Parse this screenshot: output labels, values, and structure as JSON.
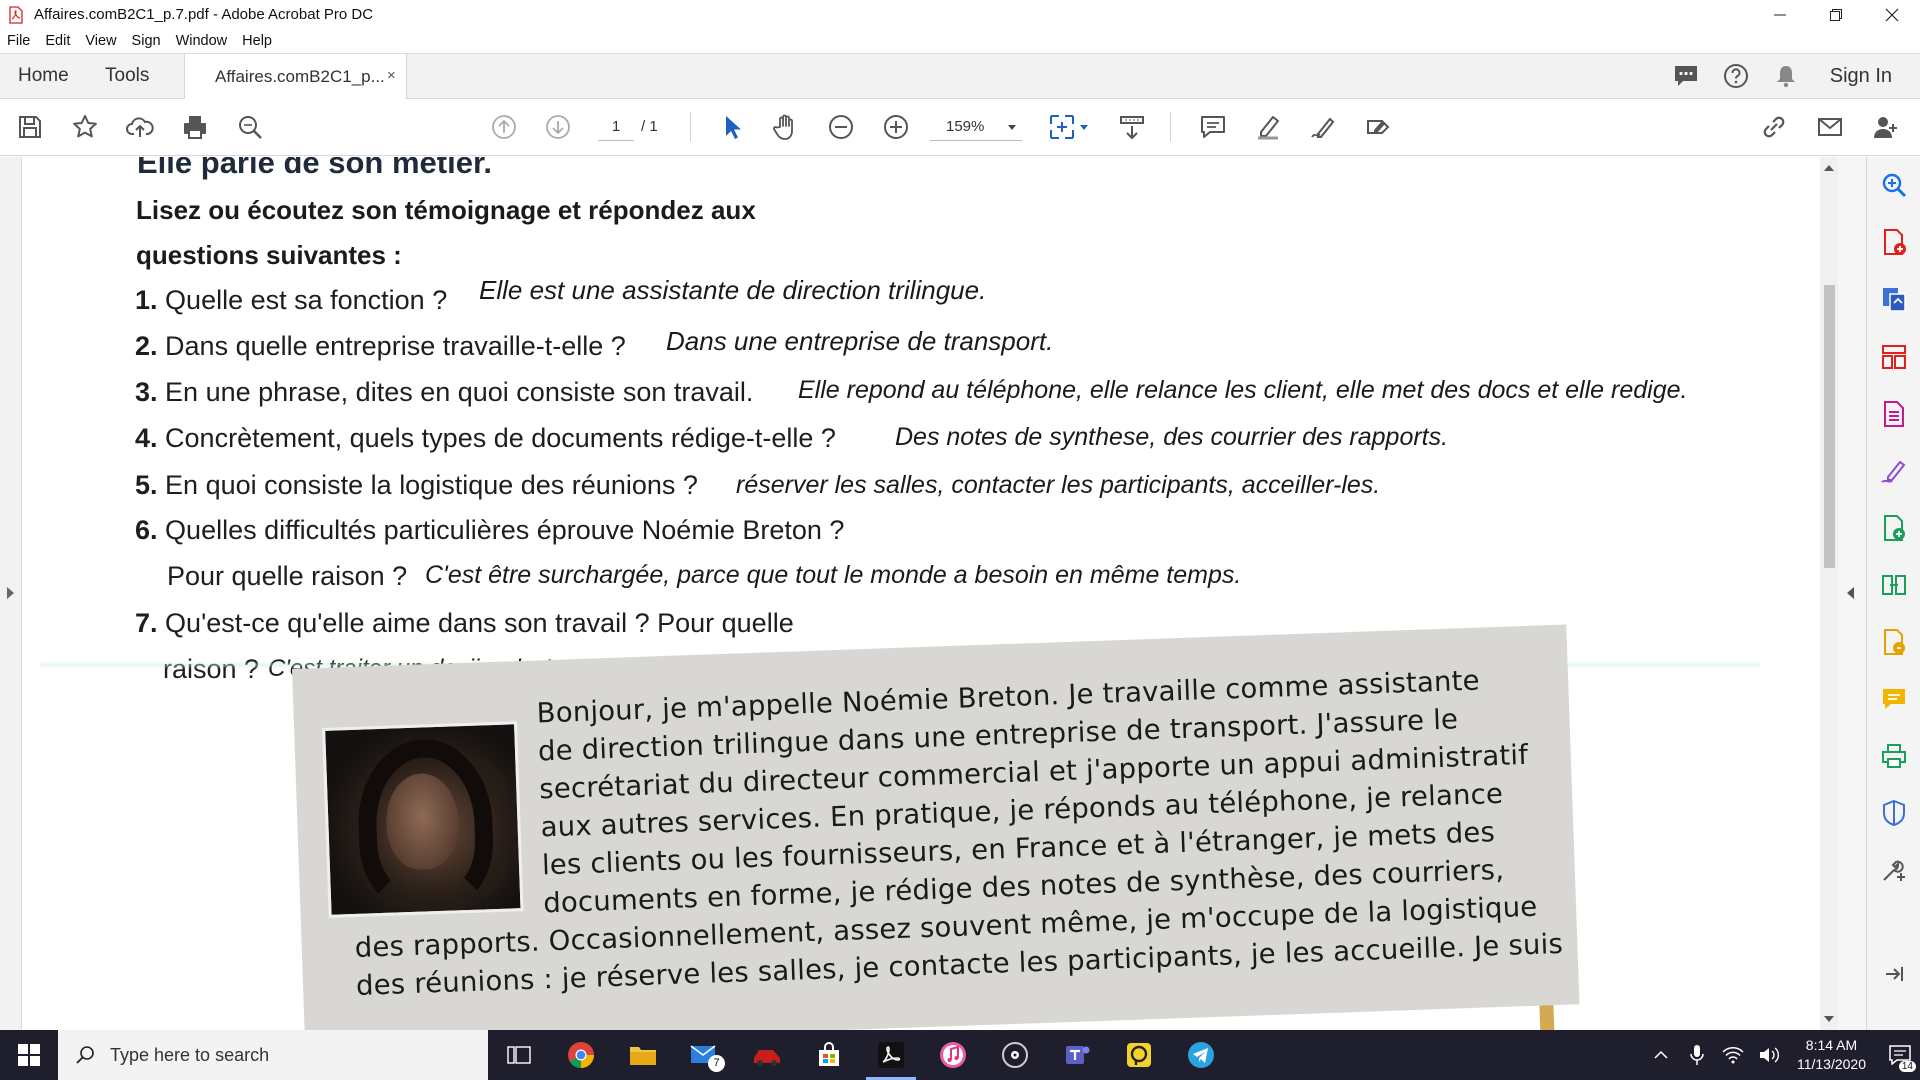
{
  "window": {
    "title": "Affaires.comB2C1_p.7.pdf - Adobe Acrobat Pro DC",
    "icon": "pdf-icon"
  },
  "menu": [
    "File",
    "Edit",
    "View",
    "Sign",
    "Window",
    "Help"
  ],
  "tabs": {
    "home": "Home",
    "tools": "Tools",
    "document": "Affaires.comB2C1_p...",
    "close": "×"
  },
  "header_right": {
    "sign_in": "Sign In"
  },
  "toolbar": {
    "page_current": "1",
    "page_total": "/ 1",
    "zoom": "159%"
  },
  "document": {
    "heading_partial": "Elle parle de son métier.",
    "instruction_line1": "Lisez ou écoutez son témoignage et répondez aux",
    "instruction_line2": "questions suivantes :",
    "questions": [
      {
        "num": "1.",
        "text": "Quelle est sa fonction ?",
        "answer": "Elle est  une assistante de direction trilingue."
      },
      {
        "num": "2.",
        "text": "Dans quelle entreprise travaille-t-elle ?",
        "answer": "Dans une entreprise de transport."
      },
      {
        "num": "3.",
        "text": "En une phrase, dites en quoi consiste son travail.",
        "answer": "Elle repond au téléphone, elle relance les client, elle met des docs et elle redige."
      },
      {
        "num": "4.",
        "text": "Concrètement, quels types de documents rédige-t-elle ?",
        "answer": "Des notes de synthese, des courrier des rapports."
      },
      {
        "num": "5.",
        "text": "En quoi consiste la logistique des réunions ?",
        "answer": "réserver les salles, contacter les participants, acceiller-les."
      },
      {
        "num": "6.",
        "text": "Quelles difficultés particulières éprouve Noémie Breton ?",
        "text2": "Pour quelle raison ?",
        "answer": "C'est être surchargée, parce que tout le monde a besoin en même temps."
      },
      {
        "num": "7.",
        "text": "Qu'est-ce qu'elle aime dans son travail ? Pour quelle",
        "text2": "raison ?",
        "answer": "C'est traiter un dosiier de A a Z. c'est là qu'elle vraiment l'impression d'appoter à l'édifice."
      }
    ],
    "testimony_lines": [
      "Bonjour, je m'appelle Noémie Breton. Je travaille comme assistante",
      "de direction trilingue dans une entreprise de transport. J'assure le",
      "secrétariat du directeur commercial et j'apporte un appui administratif",
      "aux autres services. En pratique, je réponds au téléphone, je relance",
      "les clients ou les fournisseurs, en France et à l'étranger, je mets des",
      "documents en forme, je rédige des notes de synthèse, des courriers,",
      "des rapports. Occasionnellement, assez souvent même, je m'occupe de la logistique",
      "des réunions : je réserve les salles, je contacte les participants, je les accueille. Je suis"
    ]
  },
  "taskbar": {
    "search_placeholder": "Type here to search",
    "mail_badge": "7",
    "time": "8:14 AM",
    "date": "11/13/2020",
    "notification_count": "14"
  },
  "colors": {
    "accent_blue": "#1473e6",
    "taskbar": "#1f1e2c",
    "pdf_red": "#e0201b"
  }
}
